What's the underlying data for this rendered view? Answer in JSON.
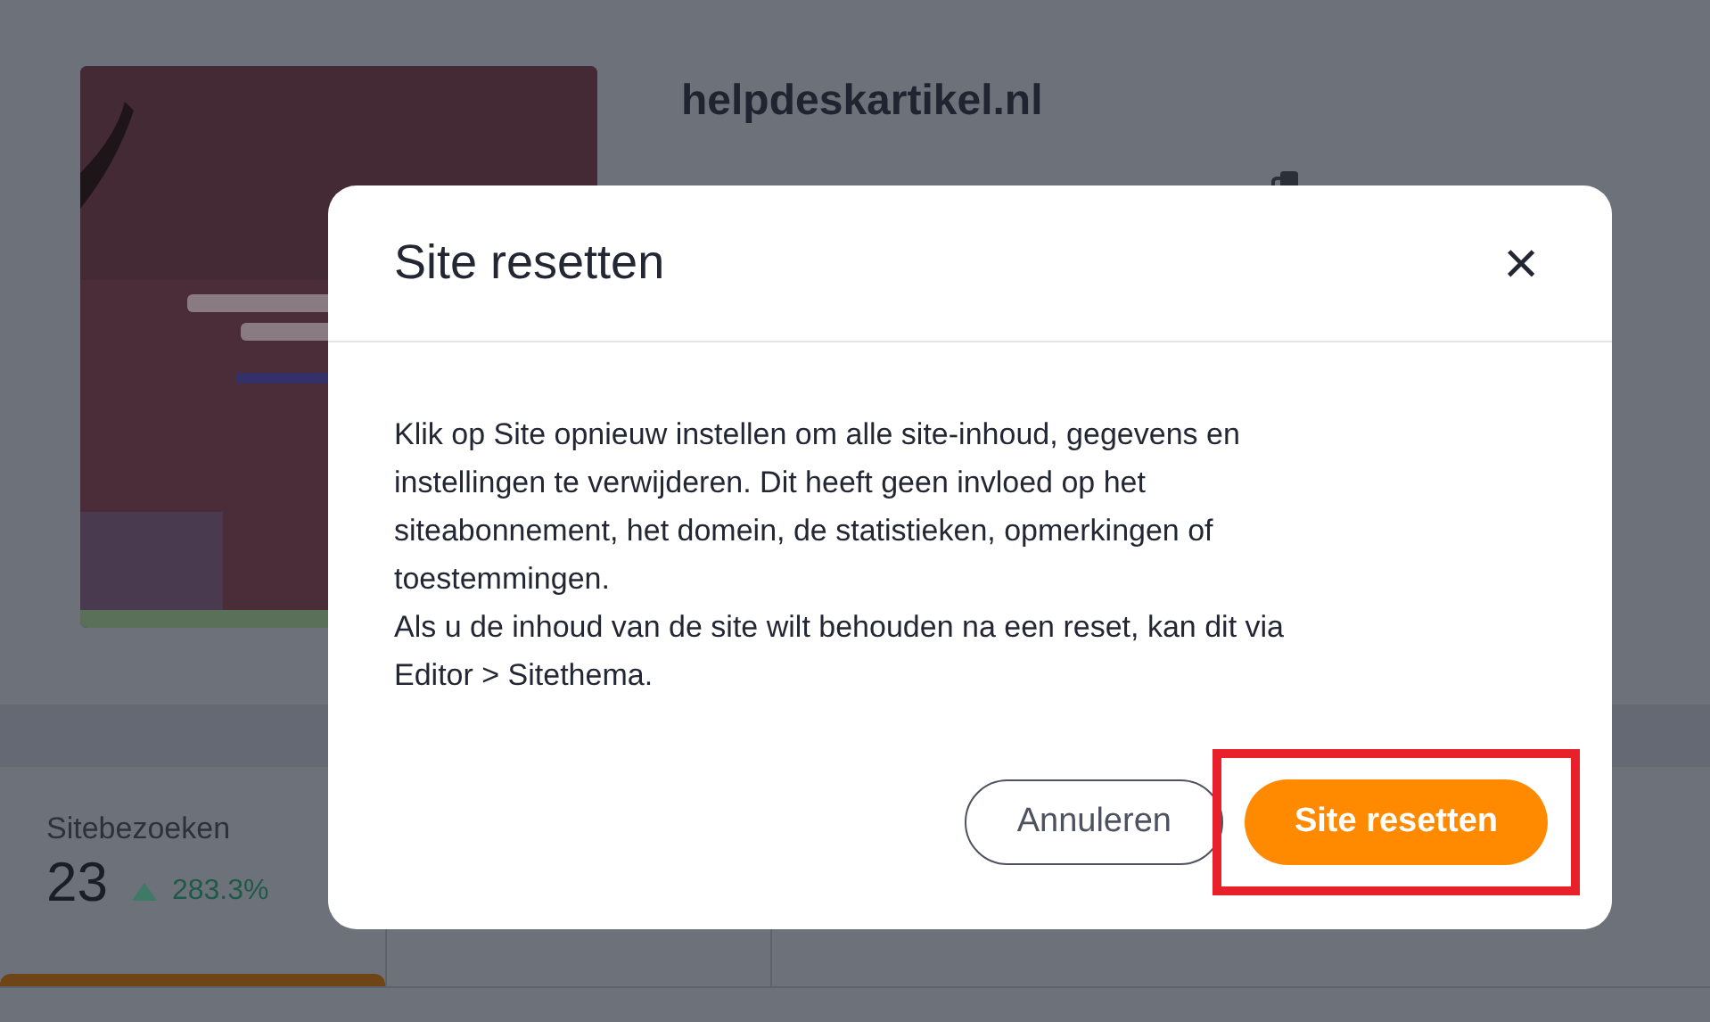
{
  "site": {
    "name": "helpdeskartikel.nl"
  },
  "stats": [
    {
      "label": "Sitebezoeken",
      "value": "23",
      "change": "283.3%",
      "rising": true
    }
  ],
  "dialog": {
    "title": "Site resetten",
    "close": "×",
    "paragraphs": [
      "Klik op Site opnieuw instellen om alle site-inhoud, gegevens en instellingen te verwijderen. Dit heeft geen invloed op het siteabonnement, het domein, de statistieken, opmerkingen of toestemmingen.",
      "Als u de inhoud van de site wilt behouden na een reset, kan dit via Editor > Sitethema."
    ],
    "buttons": [
      {
        "label": "Annuleren",
        "kind": "secondary",
        "highlighted": false
      },
      {
        "label": "Site resetten",
        "kind": "primary",
        "highlighted": true
      }
    ]
  }
}
